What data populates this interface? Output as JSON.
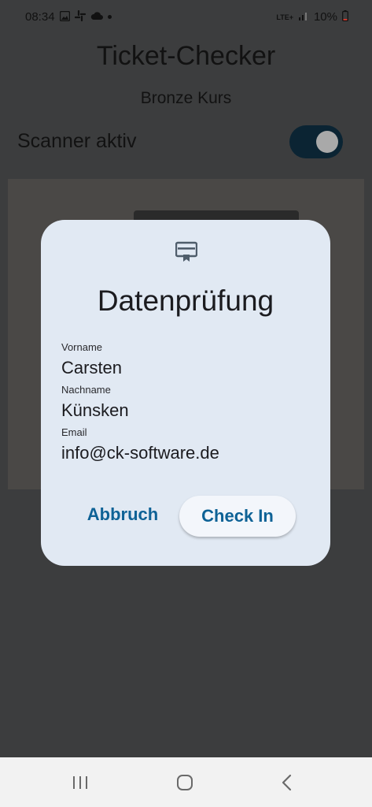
{
  "status_bar": {
    "time": "08:34",
    "network": "LTE+",
    "battery": "10%"
  },
  "app": {
    "title": "Ticket-Checker",
    "subtitle": "Bronze Kurs",
    "scanner_label": "Scanner aktiv",
    "scanner_enabled": true
  },
  "dialog": {
    "title": "Datenprüfung",
    "fields": [
      {
        "label": "Vorname",
        "value": "Carsten"
      },
      {
        "label": "Nachname",
        "value": "Künsken"
      },
      {
        "label": "Email",
        "value": "info@ck-software.de"
      }
    ],
    "cancel_label": "Abbruch",
    "confirm_label": "Check In"
  },
  "icons": {
    "dialog_icon": "ticket-icon",
    "nav": [
      "recent-apps-icon",
      "home-icon",
      "back-icon"
    ]
  },
  "colors": {
    "accent": "#0e6296",
    "dialog_background": "#e1e9f3",
    "toggle_track": "#0b2433"
  }
}
